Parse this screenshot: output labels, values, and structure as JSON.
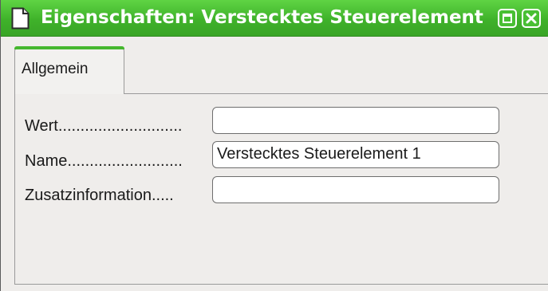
{
  "window": {
    "title": "Eigenschaften: Verstecktes Steuerelement",
    "icons": {
      "app": "document-icon",
      "maximize": "maximize-icon",
      "close": "close-icon"
    },
    "colors": {
      "titlebar": "#3fb22a",
      "tab_accent": "#45b72e"
    }
  },
  "tabs": [
    {
      "label": "Allgemein",
      "selected": true
    }
  ],
  "form": {
    "wert": {
      "label": "Wert............................",
      "value": ""
    },
    "name": {
      "label": "Name..........................",
      "value": "Verstecktes Steuerelement 1"
    },
    "zusatz": {
      "label": "Zusatzinformation.....",
      "value": ""
    }
  }
}
